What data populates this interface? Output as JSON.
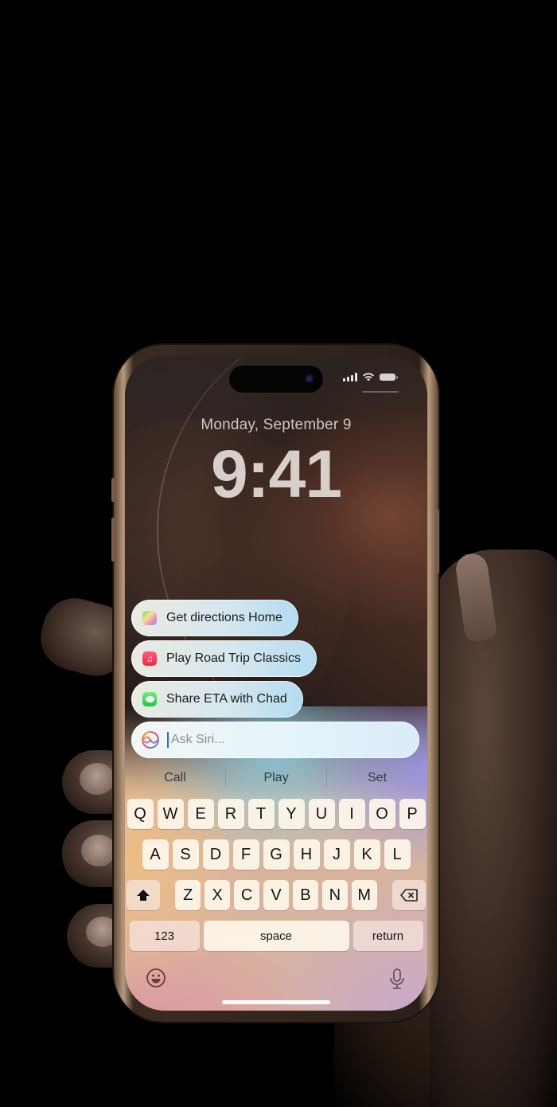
{
  "lock_screen": {
    "date": "Monday, September 9",
    "time": "9:41",
    "status_bar": {
      "signal_icon": "cellular-signal-icon",
      "wifi_icon": "wifi-icon",
      "battery_icon": "battery-icon"
    }
  },
  "siri": {
    "suggestions": [
      {
        "label": "Get directions Home",
        "icon": "maps-app-icon"
      },
      {
        "label": "Play Road Trip Classics",
        "icon": "music-app-icon"
      },
      {
        "label": "Share ETA with Chad",
        "icon": "messages-app-icon"
      }
    ],
    "input": {
      "placeholder": "Ask Siri...",
      "value": ""
    }
  },
  "predictive_bar": [
    "Call",
    "Play",
    "Set"
  ],
  "keyboard": {
    "row1": [
      "Q",
      "W",
      "E",
      "R",
      "T",
      "Y",
      "U",
      "I",
      "O",
      "P"
    ],
    "row2": [
      "A",
      "S",
      "D",
      "F",
      "G",
      "H",
      "J",
      "K",
      "L"
    ],
    "row3": [
      "Z",
      "X",
      "C",
      "V",
      "B",
      "N",
      "M"
    ],
    "numbers_label": "123",
    "space_label": "space",
    "return_label": "return",
    "shift_icon": "shift-icon",
    "delete_icon": "backspace-icon",
    "emoji_icon": "emoji-icon",
    "dictation_icon": "microphone-icon"
  }
}
